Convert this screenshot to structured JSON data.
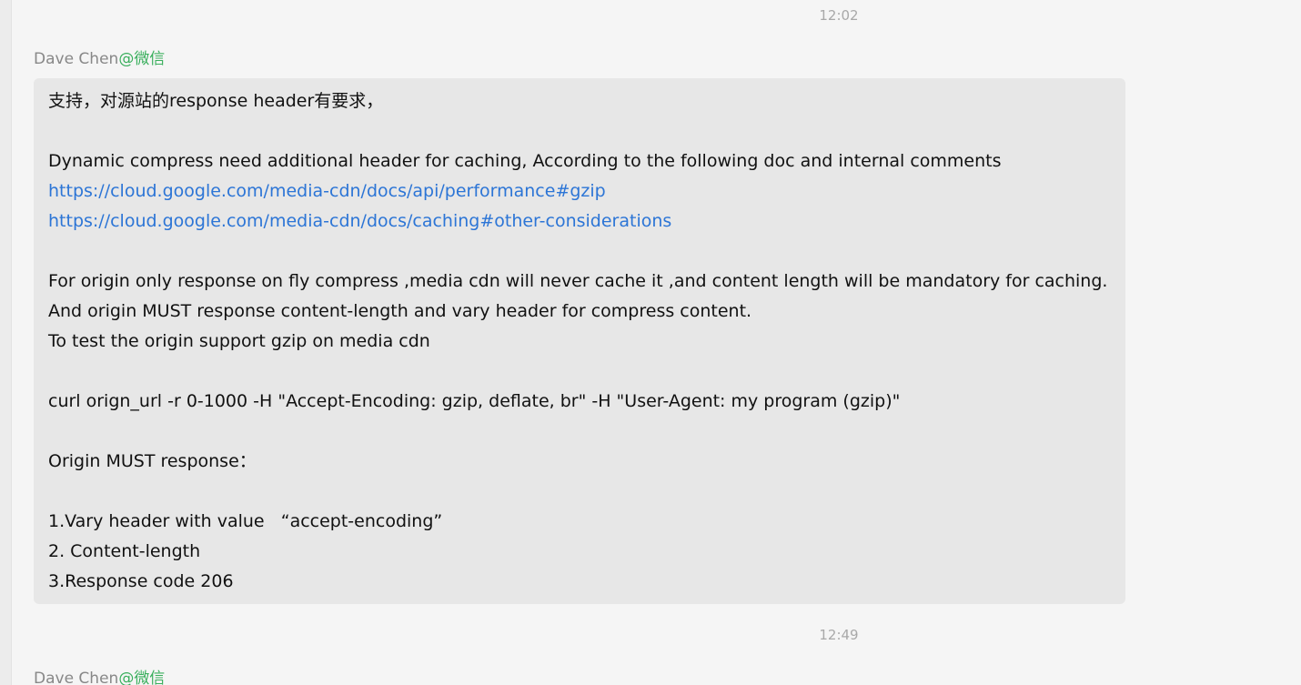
{
  "chat": {
    "messages": [
      {
        "time": "12:02",
        "sender": "Dave Chen",
        "source": "@微信",
        "lines": [
          {
            "type": "text",
            "text": "支持，对源站的response header有要求，"
          },
          {
            "type": "blank",
            "text": ""
          },
          {
            "type": "text",
            "text": "Dynamic compress need additional header for caching, According to the following doc and internal comments"
          },
          {
            "type": "link",
            "text": "https://cloud.google.com/media-cdn/docs/api/performance#gzip"
          },
          {
            "type": "link",
            "text": "https://cloud.google.com/media-cdn/docs/caching#other-considerations"
          },
          {
            "type": "blank",
            "text": ""
          },
          {
            "type": "text",
            "text": "For origin only response on fly compress ,media cdn will never cache it ,and content length will be mandatory for caching."
          },
          {
            "type": "text",
            "text": "And origin MUST response content-length and vary header for compress content."
          },
          {
            "type": "text",
            "text": "To test the origin support gzip on media cdn"
          },
          {
            "type": "blank",
            "text": ""
          },
          {
            "type": "text",
            "text": "curl orign_url -r 0-1000 -H \"Accept-Encoding: gzip, deflate, br\" -H \"User-Agent: my program (gzip)\""
          },
          {
            "type": "blank",
            "text": ""
          },
          {
            "type": "text",
            "text": "Origin MUST response："
          },
          {
            "type": "blank",
            "text": ""
          },
          {
            "type": "text",
            "text": "1.Vary header with value   “accept-encoding”"
          },
          {
            "type": "text",
            "text": "2. Content-length"
          },
          {
            "type": "text",
            "text": "3.Response code 206"
          }
        ]
      },
      {
        "time": "12:49",
        "sender": "Dave Chen",
        "source": "@微信"
      }
    ]
  }
}
